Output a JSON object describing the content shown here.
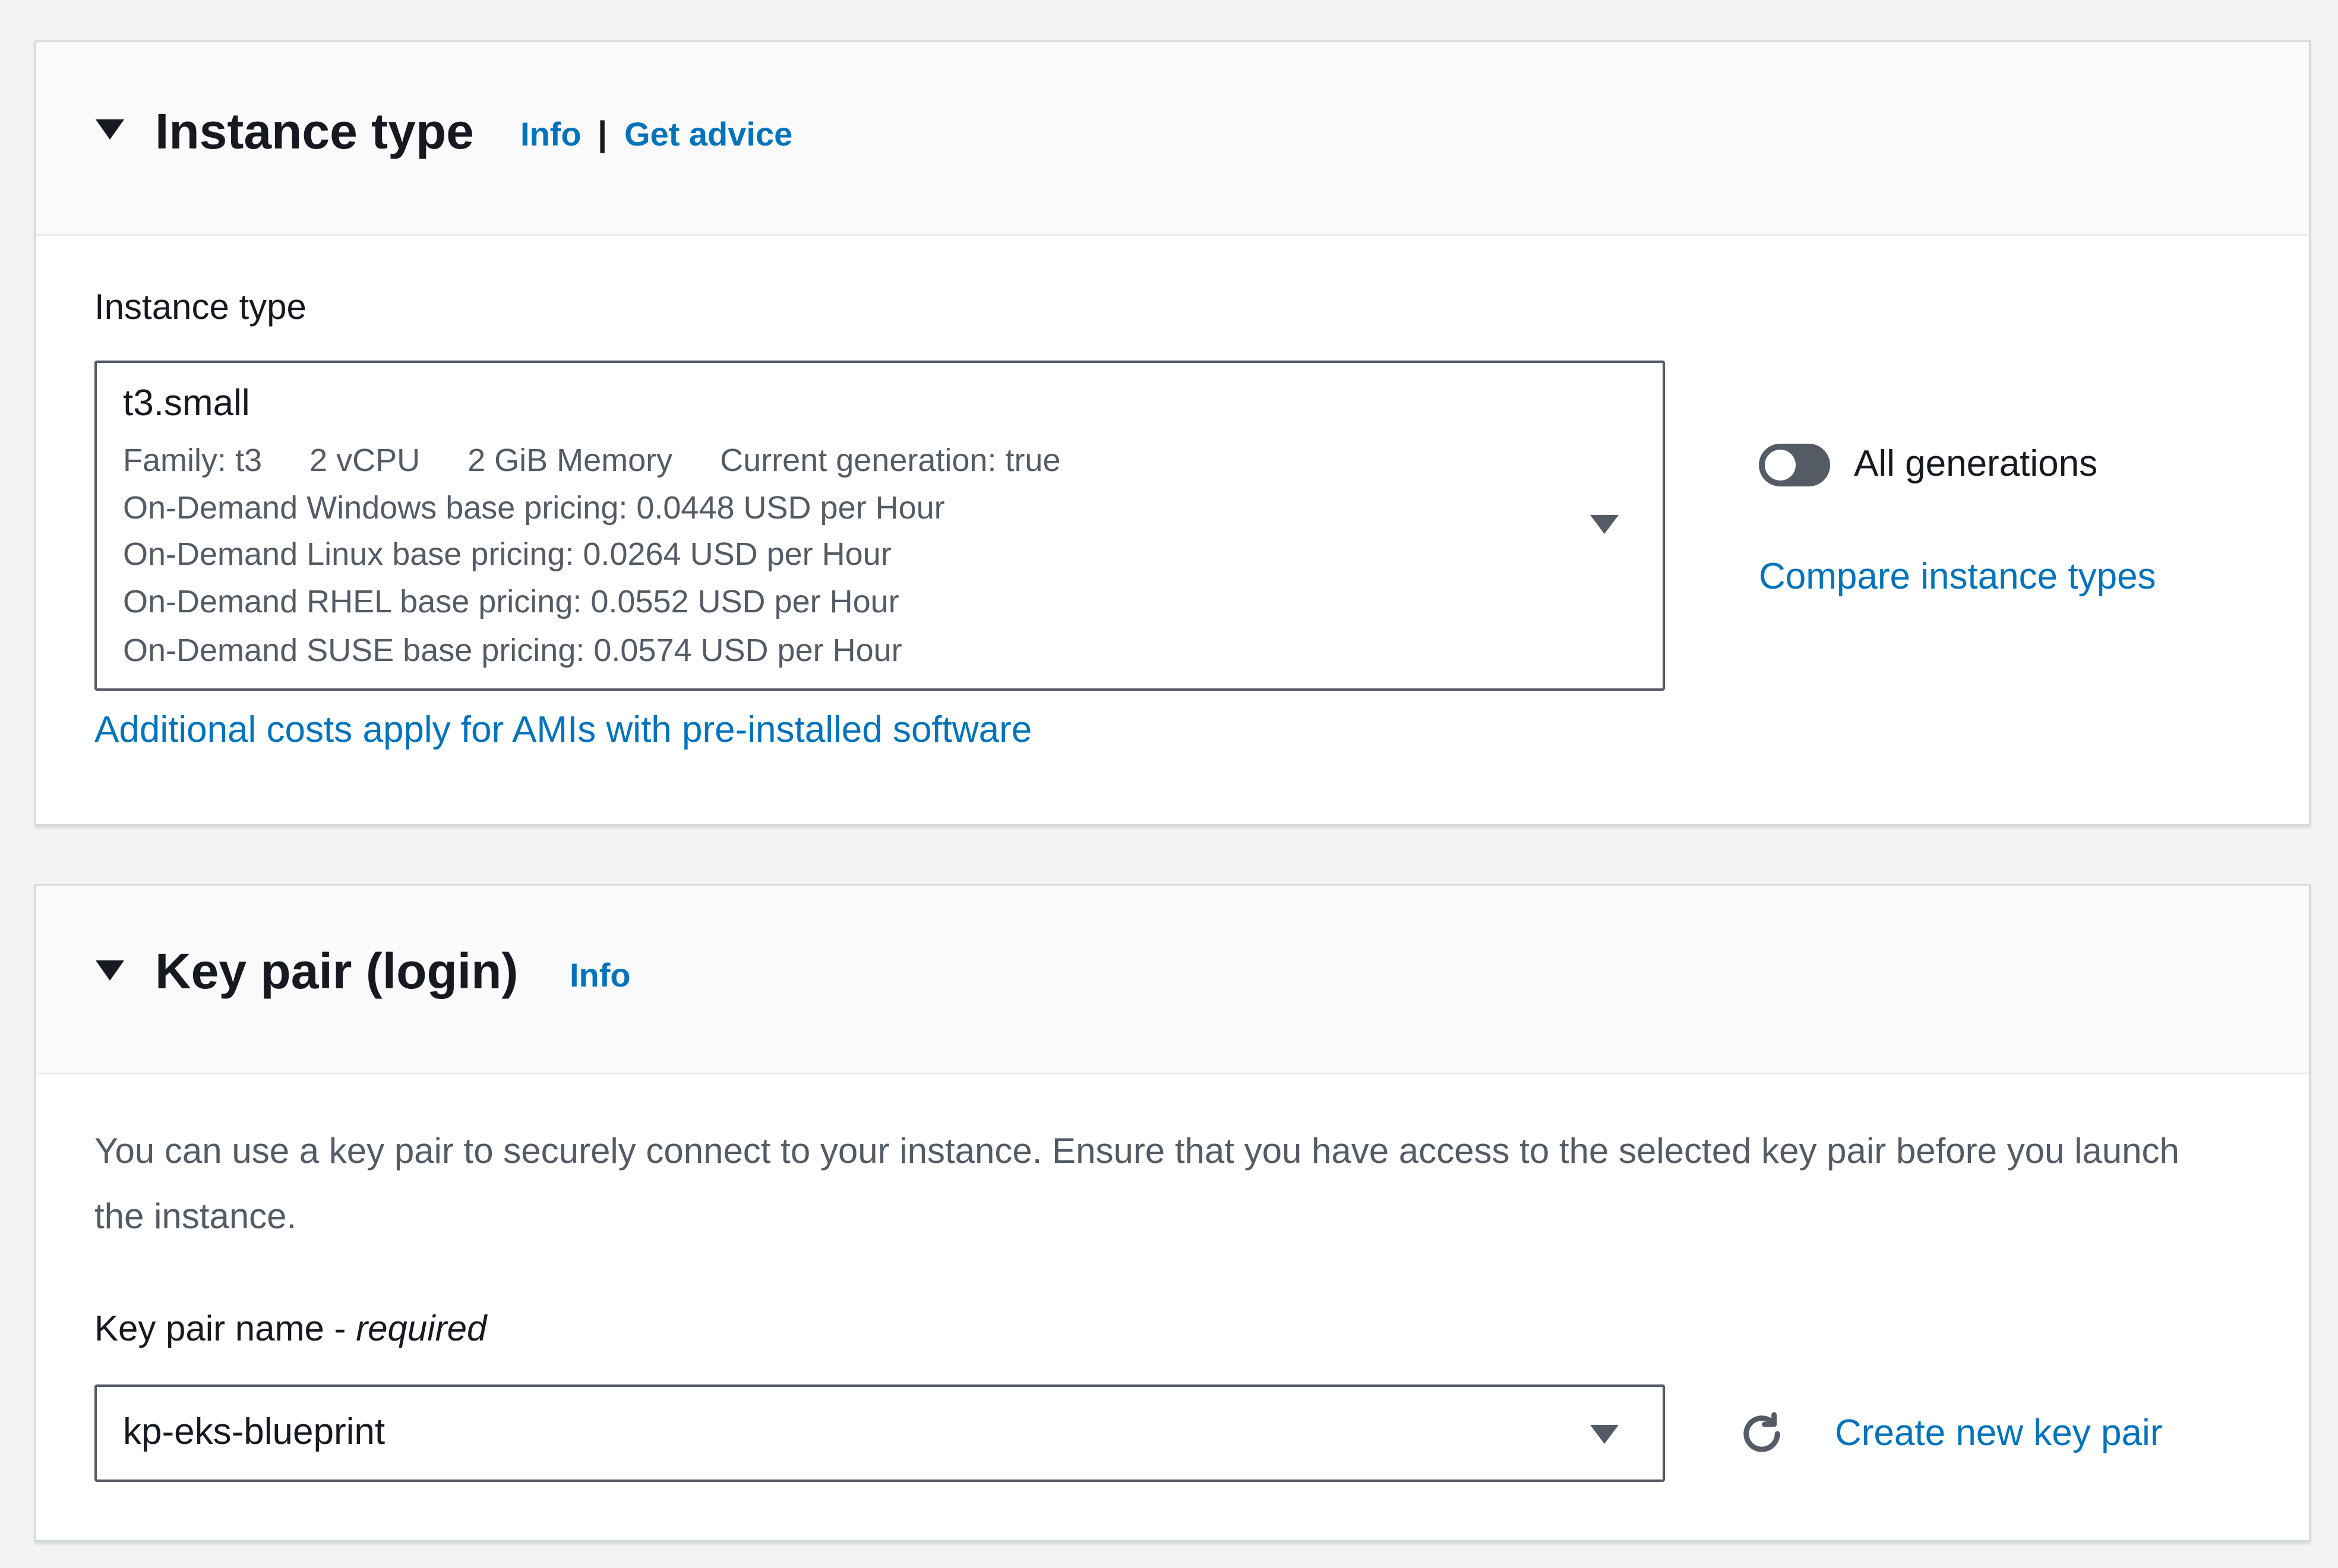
{
  "instance_type_section": {
    "title": "Instance type",
    "info_link": "Info",
    "separator": "|",
    "advice_link": "Get advice",
    "field_label": "Instance type",
    "selected_value": "t3.small",
    "meta": {
      "family": "Family: t3",
      "vcpu": "2 vCPU",
      "memory": "2 GiB Memory",
      "generation": "Current generation: true"
    },
    "pricing": [
      "On-Demand Windows base pricing: 0.0448 USD per Hour",
      "On-Demand Linux base pricing: 0.0264 USD per Hour",
      "On-Demand RHEL base pricing: 0.0552 USD per Hour",
      "On-Demand SUSE base pricing: 0.0574 USD per Hour"
    ],
    "toggle_label": "All generations",
    "toggle_on": false,
    "compare_link": "Compare instance types",
    "additional_costs_link": "Additional costs apply for AMIs with pre-installed software"
  },
  "key_pair_section": {
    "title": "Key pair (login)",
    "info_link": "Info",
    "description": "You can use a key pair to securely connect to your instance. Ensure that you have access to the selected key pair before you launch the instance.",
    "field_label": "Key pair name - ",
    "field_label_required": "required",
    "selected_value": "kp-eks-blueprint",
    "create_link": "Create new key pair"
  },
  "icons": {
    "expand": "caret-down-icon",
    "dropdown": "chevron-down-icon",
    "refresh": "refresh-icon"
  },
  "colors": {
    "link": "#0073bb",
    "text": "#16191f",
    "secondary_text": "#545b64",
    "border": "#545b64",
    "header_bg": "#fafafa",
    "page_bg": "#f2f3f3"
  }
}
